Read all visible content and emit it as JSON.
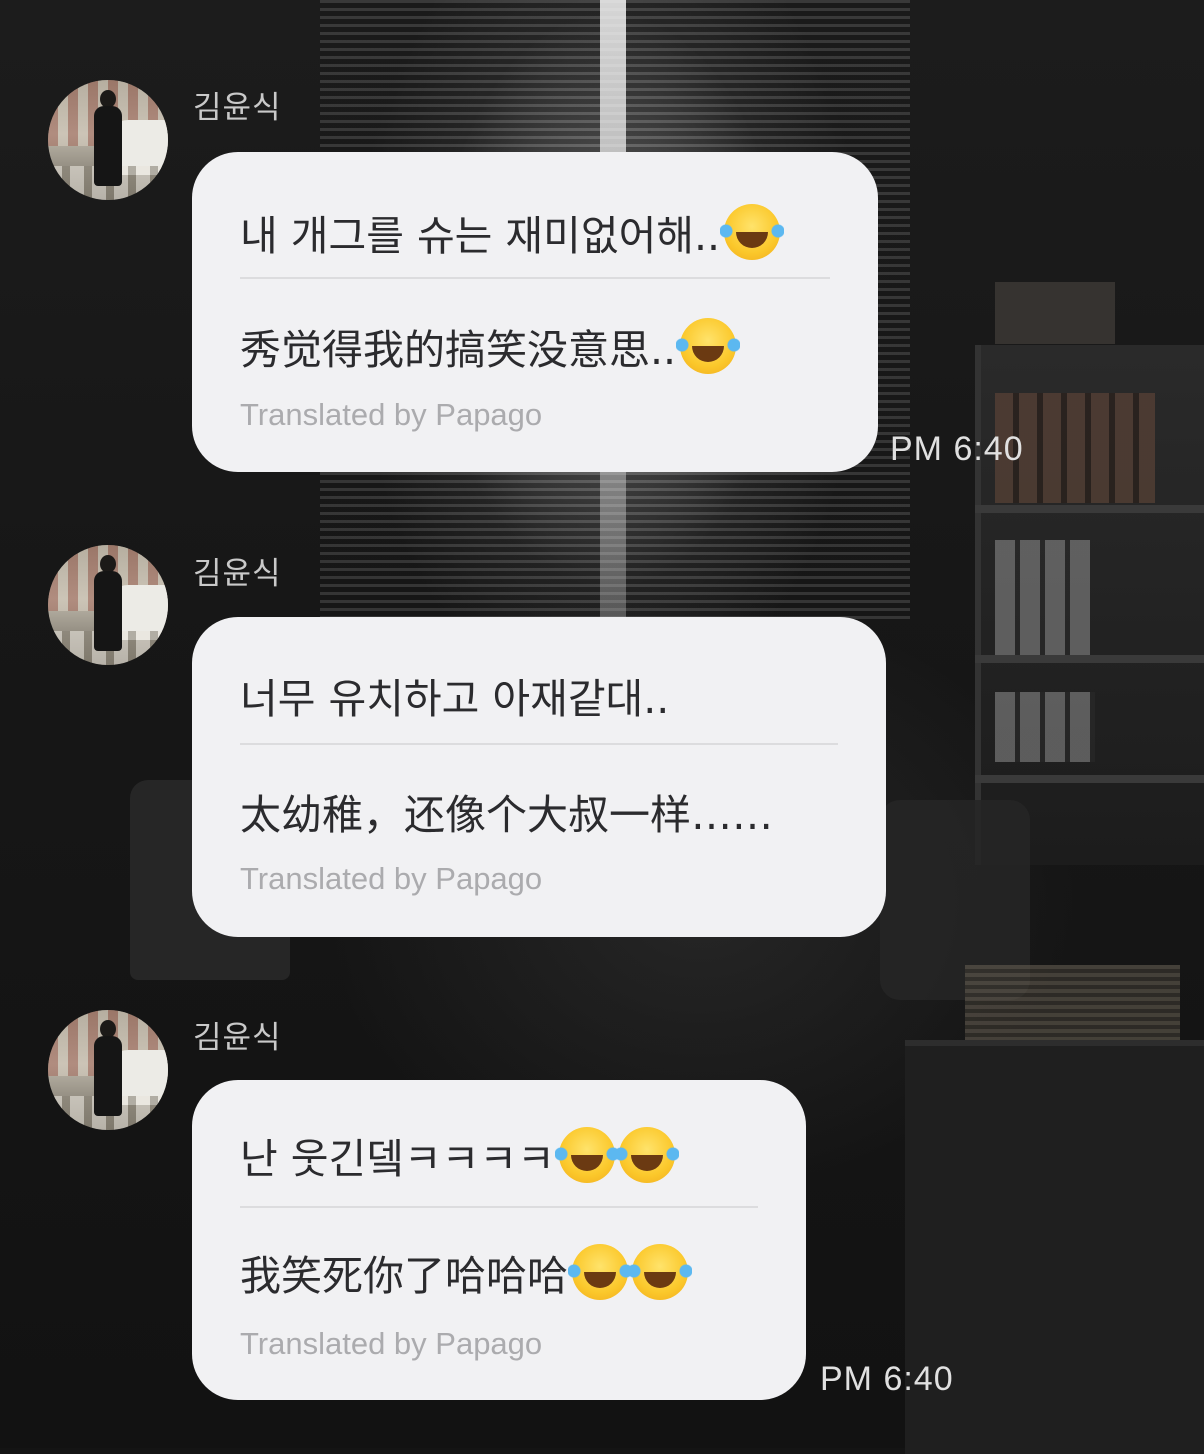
{
  "messages": [
    {
      "sender": "김윤식",
      "original": "내 개그를 슈는 재미없어해..",
      "original_emoji_count": 1,
      "translated": "秀觉得我的搞笑没意思..",
      "translated_emoji_count": 1,
      "credit": "Translated by Papago",
      "time": "PM 6:40"
    },
    {
      "sender": "김윤식",
      "original": "너무 유치하고 아재같대..",
      "original_emoji_count": 0,
      "translated": "太幼稚，还像个大叔一样……",
      "translated_emoji_count": 0,
      "credit": "Translated by Papago",
      "time": ""
    },
    {
      "sender": "김윤식",
      "original": "난 웃긴뎈ㅋㅋㅋㅋ",
      "original_emoji_count": 2,
      "translated": "我笑死你了哈哈哈",
      "translated_emoji_count": 2,
      "credit": "Translated by Papago",
      "time": "PM 6:40"
    }
  ],
  "emoji_name": "face-with-tears-of-joy",
  "colors": {
    "bubble": "#f1f1f3",
    "text": "#2b2b2e",
    "credit": "#ababae",
    "sender": "#c9c9c9",
    "time": "#e0e0e0"
  }
}
